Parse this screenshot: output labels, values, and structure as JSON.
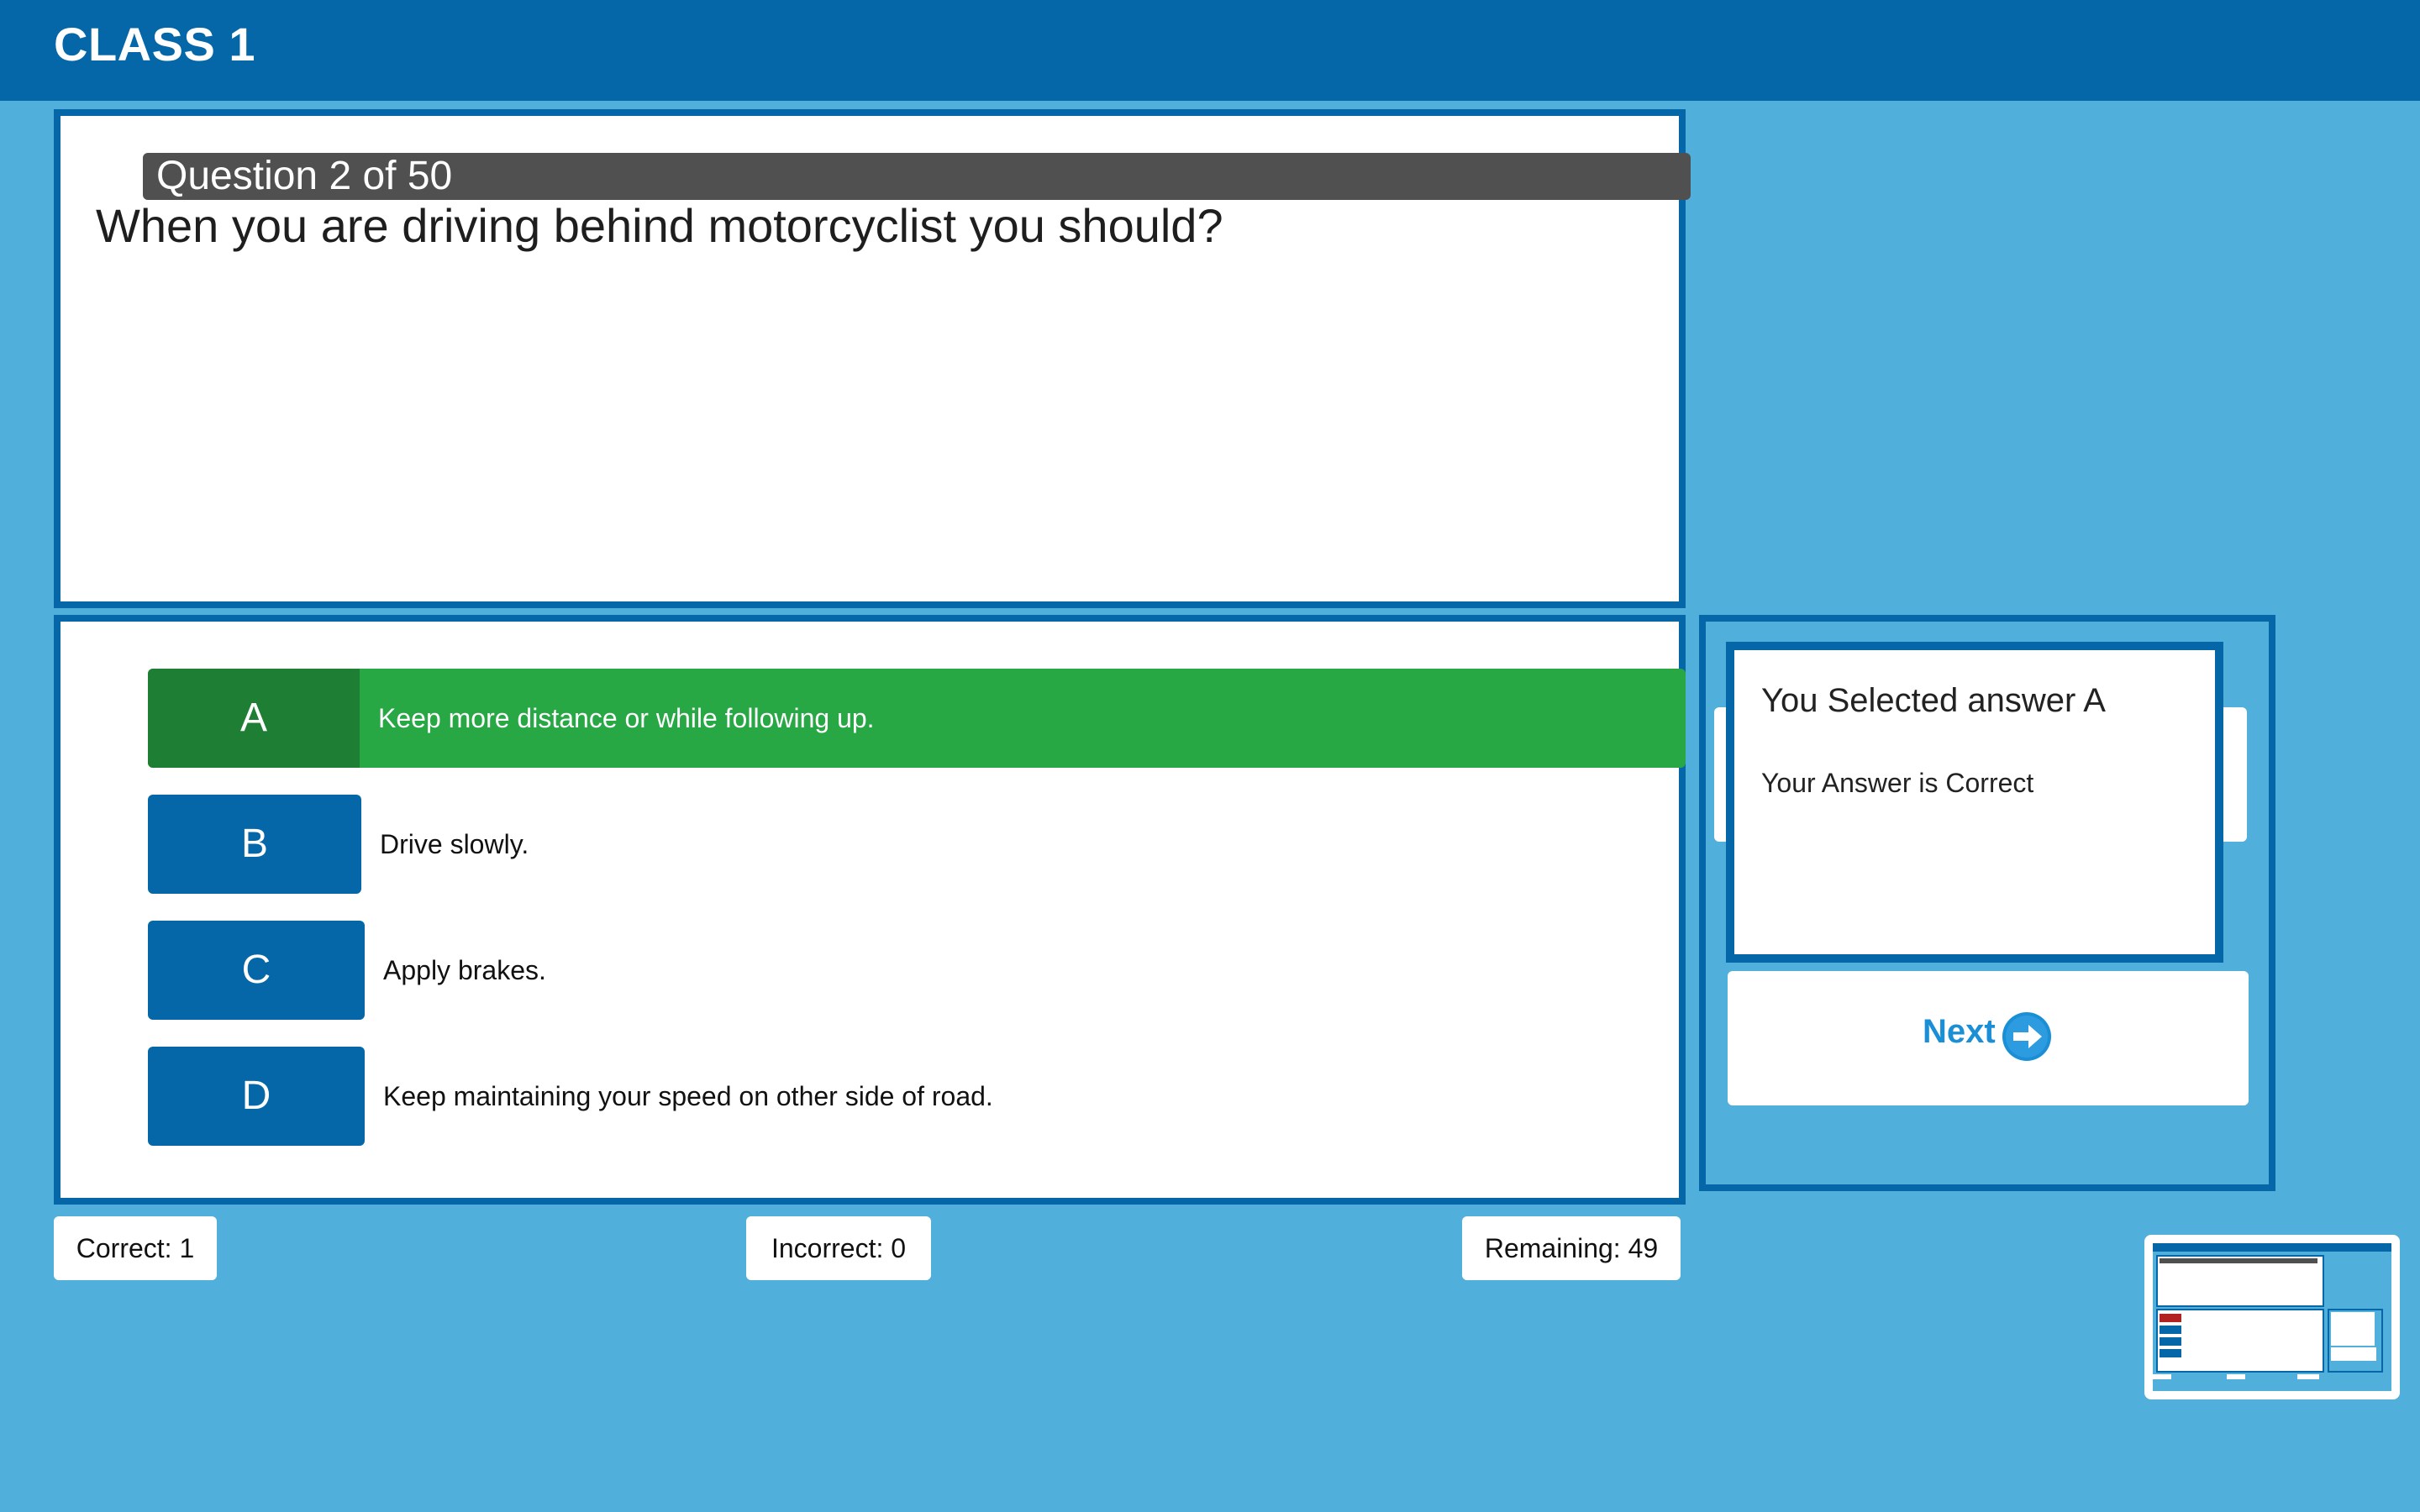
{
  "header": {
    "title": "CLASS 1"
  },
  "question": {
    "number_label": "Question 2 of 50",
    "text": "When you are driving behind motorcyclist you should?"
  },
  "options": [
    {
      "letter": "A",
      "text": "Keep more distance or while following up.",
      "selected": true
    },
    {
      "letter": "B",
      "text": "Drive slowly.",
      "selected": false
    },
    {
      "letter": "C",
      "text": "Apply brakes.",
      "selected": false
    },
    {
      "letter": "D",
      "text": "Keep maintaining your speed on other side of road.",
      "selected": false
    }
  ],
  "feedback": {
    "title": "You Selected answer A",
    "result": "Your Answer is Correct"
  },
  "next_button": {
    "label": "Next",
    "icon": "arrow-right-circle-icon"
  },
  "stats": {
    "correct": "Correct: 1",
    "incorrect": "Incorrect: 0",
    "remaining": "Remaining: 49"
  },
  "colors": {
    "background": "#50afdb",
    "header": "#0567a8",
    "option": "#0567a8",
    "selected_correct": "#28a745",
    "next": "#1a8fd6"
  }
}
